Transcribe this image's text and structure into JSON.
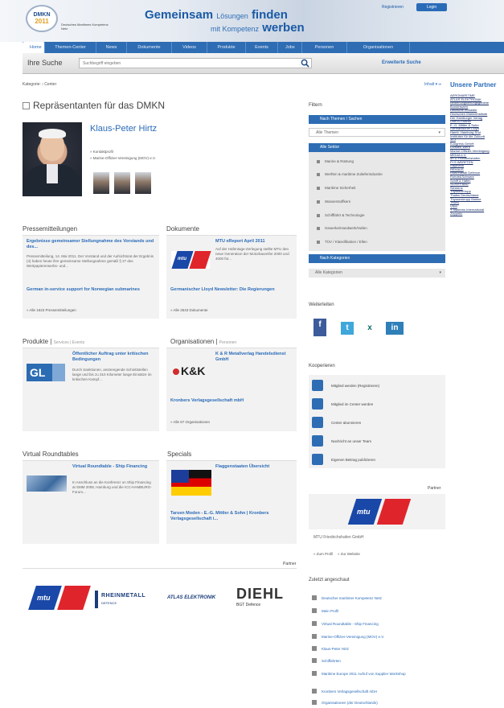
{
  "header": {
    "logo_text_1": "DMKN",
    "logo_text_2": "2011",
    "logo_caption": "Deutsches Maritimes Kompetenz Netz",
    "slogan_1_bold": "Gemeinsam",
    "slogan_1_small": "Lösungen",
    "slogan_1_end": "finden",
    "slogan_2_small": "mit Kompetenz",
    "slogan_2_bold": "werben",
    "register_link": "Registrieren",
    "login_button": "Login"
  },
  "nav": {
    "items": [
      "Home",
      "Themen-Center",
      "News",
      "Dokumente",
      "Videos",
      "Produkte",
      "Events",
      "Jobs",
      "Personen",
      "Organisationen"
    ]
  },
  "search": {
    "label": "Ihre Suche",
    "placeholder": "Suchbegriff eingeben",
    "advanced": "Erweiterte Suche"
  },
  "breadcrumb": "Kategorie: › Center",
  "toplinks": "Inhalt ▾ ∞",
  "main": {
    "page_title": "Repräsentanten für das DMKN",
    "profile": {
      "name": "Klaus-Peter Hirtz",
      "meta_1": "» Kontaktprofil",
      "meta_2": "» Marine-Offizier-Vereinigung (MOV) e.V."
    },
    "press": {
      "title": "Pressemitteilungen",
      "headline": "Ergebnisse gemeinsamer Stellungnahme des Vorstands und des...",
      "text": "Pressemitteilung, 14. Mai 2011. Der Vorstand und der Aufsichtsrat der Ergebnis (4) haben heute ihre gemeinsame Stellungnahme gemäß § 27 des Wertpapiererwerbs- und...",
      "headline_2": "German in-service support for Norwegian submarines",
      "more": "» Alle 1623 Pressemitteilungen"
    },
    "documents": {
      "title": "Dokumente",
      "headline": "MTU eReport April 2011",
      "text": "Auf der Hafentage-Zerlegung stellte MTU den neue Generation der Motorbaureihe 2000 und 4000 für...",
      "headline_2": "Germanischer Lloyd Newsletter: Die Regierungen",
      "more": "» Alle 2643 Dokumente"
    },
    "products": {
      "title": "Produkte",
      "sub": "Services | Events",
      "headline": "Öffentlicher Auftrag unter kritischen Bedingungen",
      "text": "Durch Sanktionen, anstrengende Schnittstellen lange und bis zu 310 Kilometer lange Einsätze im kritischen Kampf...",
      "logo": "GL"
    },
    "organizations": {
      "title": "Organisationen",
      "sub": "Personen",
      "headline": "K & R Metallverlag Handelsdienst GmbH",
      "headline_2": "Kronbers Verlagsgesellschaft mbH",
      "logo": "K&K",
      "more": "» Alle 67 Organisationen"
    },
    "roundtables": {
      "title": "Virtual Roundtables",
      "headline": "Virtual Roundtable - Ship Financing",
      "text": "In Anschluss an die Konferenz on Ship Financing at SMM 2008, Hamburg und die ICC-HAMBURG-Forum..."
    },
    "specials": {
      "title": "Specials",
      "headline": "Flaggenstaaten Übersicht",
      "headline_2": "Tarsen Moden - E.-G. Mittler & Sohn | Kronbers Verlagsgesellschaft i..."
    },
    "partner_label": "Partner",
    "partner_logos": {
      "mtu": "mtu",
      "rheinmetall": "RHEINMETALL",
      "rheinmetall_sub": "DEFENCE",
      "ess": "ATLAS ELEKTRONIK",
      "diehl": "DIEHL",
      "diehl_sub": "BGT Defence"
    }
  },
  "sidebar": {
    "filter_label": "Filtern",
    "theme_header": "Nach Themen / Sachen",
    "theme_select": "Alle Themen",
    "sector_header": "Alle Sektor",
    "sector_items": [
      "Marine & Rüstung",
      "Werften & maritime Zulieferindustrie",
      "Maritime Sicherheit",
      "Wasserstoffkern",
      "Schifffahrt & Technologie",
      "Gewerke/Handwerk/Hafen",
      "TÜV / Klassifikation / Ellen"
    ],
    "category_header": "Nach Kategorien",
    "category_select": "Alle Kategorien",
    "further_label": "Weiterleiten",
    "social": [
      "f",
      "t",
      "x",
      "in"
    ],
    "cooperate_label": "Kooperieren",
    "actions": [
      "Mitglied werden (Registrieren)",
      "Mitglied im Center werden",
      "Center abonnieren",
      "Nachricht an unser Team",
      "Eigenen Beitrag publizieren"
    ],
    "partner_label": "Partner",
    "partner_logo": "mtu",
    "partner_name": "MTU Friedrichshafen GmbH",
    "profile_link": "» Zum Profil",
    "website_link": "» Zur Website",
    "recent_label": "Zuletzt angeschaut",
    "recent_items": [
      "Deutscher maritimer Kompetenz Netz",
      "Mein Profil",
      "Virtual Roundtable - Ship Financing",
      "Marine-Offizier-Vereinigung (MOV) e.V.",
      "Klaus-Peter Hirtz",
      "Schiffahrten",
      "Maritime Europe 2011 Aufruf von Supplier Workshop",
      "Kronbers Verlagsgesellschaft mbH",
      "Organisationen (der Deutschlands)"
    ],
    "partners_title": "Unsere Partner",
    "partners_list": [
      "AEROMARITIME",
      "ATLAS ELEKTRONIK",
      "Bedienungsleitungsgebiete",
      "Bundeswehr",
      "Deutsche Industrie",
      "Deutschen Marineinstitute",
      "Der Hamburger Verlag",
      "DMKN Partner",
      "E.-G. Mittler & Sohn",
      "Germanischer Lloyd",
      "Hamb. Hamburg-Süd",
      "Instituten für die Zukunft",
      "JCJ",
      "Kongress GmbH",
      "Lürssen Werft",
      "Marine-Offizier-Vereinigung",
      "MEDIA e.V.",
      "MTU Friedrichshafen",
      "P+S WERFTEN",
      "Raytheon",
      "REHAUS",
      "Rheinmetall Defence",
      "Rohde&Schwarz",
      "Schiff & Hafen",
      "SCHIFFBAU",
      "Siemens",
      "ThyssenKrupp",
      "Thales Deutschland",
      "Thyssenkrupp Marine",
      "TKMS",
      "VSM",
      "Y Systems International",
      "Zeppelin"
    ]
  },
  "colors": {
    "accent_blue": "#2e6db4",
    "link_blue": "#2a6bb8",
    "mtu_blue": "#1a48a8",
    "mtu_red": "#e0242c"
  },
  "icons": {
    "search": "magnifier-icon",
    "title": "document-icon"
  }
}
